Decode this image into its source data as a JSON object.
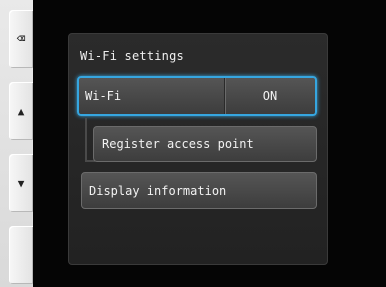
{
  "sidebar": {
    "buttons": [
      {
        "name": "delete",
        "glyph": "⌫"
      },
      {
        "name": "up",
        "glyph": "▲"
      },
      {
        "name": "down",
        "glyph": "▼"
      },
      {
        "name": "blank",
        "glyph": ""
      }
    ]
  },
  "panel": {
    "title": "Wi-Fi settings",
    "wifi": {
      "label": "Wi-Fi",
      "value": "ON"
    },
    "register_label": "Register access point",
    "display_info_label": "Display information"
  },
  "colors": {
    "focus_border": "#36a6e0",
    "screen_bg": "#050505"
  }
}
